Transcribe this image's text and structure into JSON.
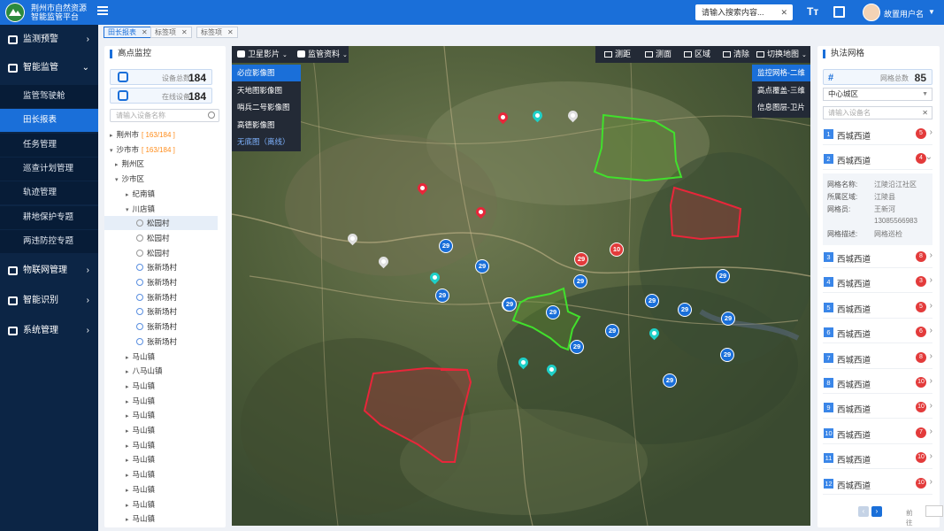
{
  "header": {
    "title_line1": "荆州市自然资源",
    "title_line2": "智能监管平台",
    "search_placeholder": "请输入搜索内容...",
    "font_icon": "Tт",
    "username": "故置用户名"
  },
  "tabs": [
    {
      "label": "田长报表",
      "active": true
    },
    {
      "label": "标签项",
      "active": false
    },
    {
      "label": "标签项",
      "active": false
    }
  ],
  "sidebar": {
    "groups": [
      {
        "label": "监测预警",
        "icon": "monitor-icon"
      },
      {
        "label": "智能监管",
        "icon": "chart-icon",
        "expanded": true
      },
      {
        "label": "物联网管理",
        "icon": "iot-icon"
      },
      {
        "label": "智能识别",
        "icon": "recognition-icon"
      },
      {
        "label": "系统管理",
        "icon": "settings-icon"
      }
    ],
    "sub_items": [
      "监管驾驶舱",
      "田长报表",
      "任务管理",
      "巡查计划管理",
      "轨迹管理",
      "耕地保护专题",
      "两违防控专题"
    ]
  },
  "tree_panel": {
    "title": "高点监控",
    "device_total_label": "设备总数",
    "device_total": "184",
    "online_label": "在线设备",
    "online": "184",
    "search_placeholder": "请输入设备名称",
    "nodes": [
      {
        "label": "荆州市",
        "count": "[ 163/184 ]",
        "level": 0,
        "arrow": "▸"
      },
      {
        "label": "沙市市",
        "count": "[ 163/184 ]",
        "level": 0,
        "arrow": "▾"
      },
      {
        "label": "荆州区",
        "count": "",
        "level": 1,
        "arrow": "▸"
      },
      {
        "label": "沙市区",
        "count": "",
        "level": 1,
        "arrow": "▾"
      },
      {
        "label": "纪南镇",
        "count": "",
        "level": 2,
        "arrow": "▸"
      },
      {
        "label": "川店镇",
        "count": "",
        "level": 2,
        "arrow": "▾"
      },
      {
        "label": "松园村",
        "count": "",
        "level": 3,
        "leaf": "grey",
        "selected": true
      },
      {
        "label": "松园村",
        "count": "",
        "level": 3,
        "leaf": "grey"
      },
      {
        "label": "松园村",
        "count": "",
        "level": 3,
        "leaf": "grey"
      },
      {
        "label": "张新场村",
        "count": "",
        "level": 3,
        "leaf": "blue"
      },
      {
        "label": "张新场村",
        "count": "",
        "level": 3,
        "leaf": "blue"
      },
      {
        "label": "张新场村",
        "count": "",
        "level": 3,
        "leaf": "blue"
      },
      {
        "label": "张新场村",
        "count": "",
        "level": 3,
        "leaf": "blue"
      },
      {
        "label": "张新场村",
        "count": "",
        "level": 3,
        "leaf": "blue"
      },
      {
        "label": "张新场村",
        "count": "",
        "level": 3,
        "leaf": "blue"
      },
      {
        "label": "马山镇",
        "count": "",
        "level": 2,
        "arrow": "▸"
      },
      {
        "label": "八马山镇",
        "count": "",
        "level": 2,
        "arrow": "▸"
      },
      {
        "label": "马山镇",
        "count": "",
        "level": 2,
        "arrow": "▸"
      },
      {
        "label": "马山镇",
        "count": "",
        "level": 2,
        "arrow": "▸"
      },
      {
        "label": "马山镇",
        "count": "",
        "level": 2,
        "arrow": "▸"
      },
      {
        "label": "马山镇",
        "count": "",
        "level": 2,
        "arrow": "▸"
      },
      {
        "label": "马山镇",
        "count": "",
        "level": 2,
        "arrow": "▸"
      },
      {
        "label": "马山镇",
        "count": "",
        "level": 2,
        "arrow": "▸"
      },
      {
        "label": "马山镇",
        "count": "",
        "level": 2,
        "arrow": "▸"
      },
      {
        "label": "马山镇",
        "count": "",
        "level": 2,
        "arrow": "▸"
      },
      {
        "label": "马山镇",
        "count": "",
        "level": 2,
        "arrow": "▸"
      },
      {
        "label": "马山镇",
        "count": "",
        "level": 2,
        "arrow": "▸"
      }
    ]
  },
  "map": {
    "toolbar_left": [
      "卫星影片",
      "监管资料"
    ],
    "toolbar_right": [
      "测距",
      "测面",
      "区域",
      "清除",
      "切换地图"
    ],
    "layers": [
      {
        "label": "必应影像图",
        "active": true
      },
      {
        "label": "天地图影像图",
        "active": false
      },
      {
        "label": "哨兵二号影像图",
        "active": false
      },
      {
        "label": "高德影像图",
        "active": false
      },
      {
        "label": "无底图（离线）",
        "active": false,
        "offline": true
      }
    ],
    "modes": [
      {
        "label": "监控网格-二维",
        "active": true
      },
      {
        "label": "高点覆盖-三维",
        "active": false
      },
      {
        "label": "信息图层-卫片",
        "active": false
      }
    ],
    "pins": [
      {
        "color": "#e8263a"
      },
      {
        "color": "#1fd0c8"
      },
      {
        "color": "#e0e0e0"
      },
      {
        "color": "#e8263a"
      },
      {
        "color": "#e8263a"
      },
      {
        "color": "#e0e0e0"
      },
      {
        "color": "#e0e0e0"
      },
      {
        "color": "#1fd0c8"
      },
      {
        "color": "#1fd0c8"
      },
      {
        "color": "#1fd0c8"
      },
      {
        "color": "#1fd0c8"
      }
    ],
    "badges": [
      {
        "value": "29",
        "color": "#1a6fd9"
      },
      {
        "value": "29",
        "color": "#1a6fd9"
      },
      {
        "value": "29",
        "color": "#1a6fd9"
      },
      {
        "value": "29",
        "color": "#1a6fd9"
      },
      {
        "value": "29",
        "color": "#e33b3b"
      },
      {
        "value": "10",
        "color": "#e33b3b"
      },
      {
        "value": "29",
        "color": "#1a6fd9"
      },
      {
        "value": "29",
        "color": "#1a6fd9"
      },
      {
        "value": "29",
        "color": "#1a6fd9"
      },
      {
        "value": "29",
        "color": "#1a6fd9"
      },
      {
        "value": "29",
        "color": "#1a6fd9"
      },
      {
        "value": "29",
        "color": "#1a6fd9"
      },
      {
        "value": "29",
        "color": "#1a6fd9"
      },
      {
        "value": "29",
        "color": "#1a6fd9"
      },
      {
        "value": "29",
        "color": "#1a6fd9"
      },
      {
        "value": "29",
        "color": "#1a6fd9"
      },
      {
        "value": "29",
        "color": "#1a6fd9"
      }
    ]
  },
  "grid_panel": {
    "title": "执法网格",
    "total_label": "网格总数",
    "total": "85",
    "region": "中心城区",
    "search_placeholder": "请输入设备名",
    "rows": [
      {
        "num": "1",
        "name": "西城西道",
        "badge": "5",
        "chev": "›"
      },
      {
        "num": "2",
        "name": "西城西道",
        "badge": "4",
        "chev": "⌄"
      },
      {
        "num": "3",
        "name": "西城西道",
        "badge": "8",
        "chev": "›"
      },
      {
        "num": "4",
        "name": "西城西道",
        "badge": "3",
        "chev": "›"
      },
      {
        "num": "5",
        "name": "西城西道",
        "badge": "5",
        "chev": "›"
      },
      {
        "num": "6",
        "name": "西城西道",
        "badge": "6",
        "chev": "›"
      },
      {
        "num": "7",
        "name": "西城西道",
        "badge": "8",
        "chev": "›"
      },
      {
        "num": "8",
        "name": "西城西道",
        "badge": "10",
        "chev": "›"
      },
      {
        "num": "9",
        "name": "西城西道",
        "badge": "10",
        "chev": "›"
      },
      {
        "num": "10",
        "name": "西城西道",
        "badge": "7",
        "chev": "›"
      },
      {
        "num": "11",
        "name": "西城西道",
        "badge": "10",
        "chev": "›"
      },
      {
        "num": "12",
        "name": "西城西道",
        "badge": "10",
        "chev": "›"
      }
    ],
    "detail": {
      "name_label": "网格名称:",
      "name": "江陵沿江社区",
      "area_label": "所属区域:",
      "area": "江陵县",
      "member_label": "网格员:",
      "member": "王新河",
      "phone": "13085566983",
      "desc_label": "网格描述:",
      "desc": "网格巡检"
    },
    "pager": {
      "goto_label": "前往",
      "unit": "页"
    }
  }
}
